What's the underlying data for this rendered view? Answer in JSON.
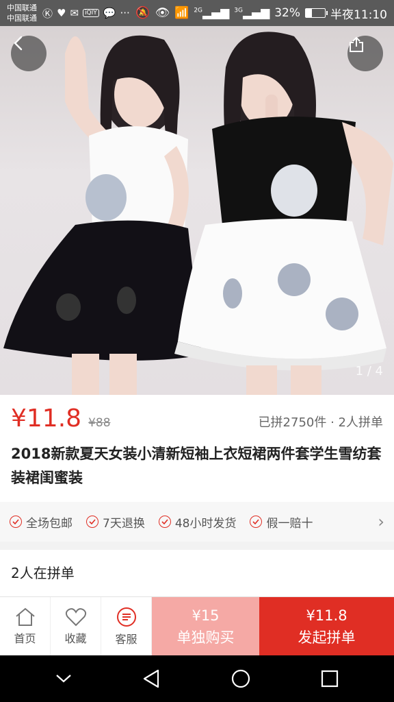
{
  "status_bar": {
    "carrier_1": "中国联通",
    "carrier_2": "中国联通",
    "signal_1": "2G",
    "signal_2": "3G",
    "battery_percent": "32%",
    "battery_level": 0.32,
    "time": "半夜11:10",
    "app_badge": "iQIY"
  },
  "gallery": {
    "indicator": "1 / 4",
    "current": 1,
    "total": 4
  },
  "product": {
    "price": "¥11.8",
    "original_price": "¥88",
    "sold_info": "已拼2750件 · 2人拼单",
    "title": "2018新款夏天女装小清新短袖上衣短裙两件套学生雪纺套装裙闺蜜装"
  },
  "services": [
    {
      "label": "全场包邮"
    },
    {
      "label": "7天退换"
    },
    {
      "label": "48小时发货"
    },
    {
      "label": "假一赔十"
    }
  ],
  "group_buy": {
    "title": "2人在拼单"
  },
  "bottom_bar": {
    "home_label": "首页",
    "favorite_label": "收藏",
    "service_label": "客服",
    "buy_alone_price": "¥15",
    "buy_alone_label": "单独购买",
    "buy_group_price": "¥11.8",
    "buy_group_label": "发起拼单"
  },
  "colors": {
    "accent": "#e02e24",
    "buy_alone_bg": "#f5a9a5"
  },
  "icons": [
    "back-arrow-icon",
    "share-icon",
    "check-circle-icon",
    "chevron-right-icon",
    "home-icon",
    "heart-icon",
    "chat-icon",
    "nav-back-icon",
    "nav-home-icon",
    "nav-recent-icon",
    "nav-collapse-icon"
  ]
}
